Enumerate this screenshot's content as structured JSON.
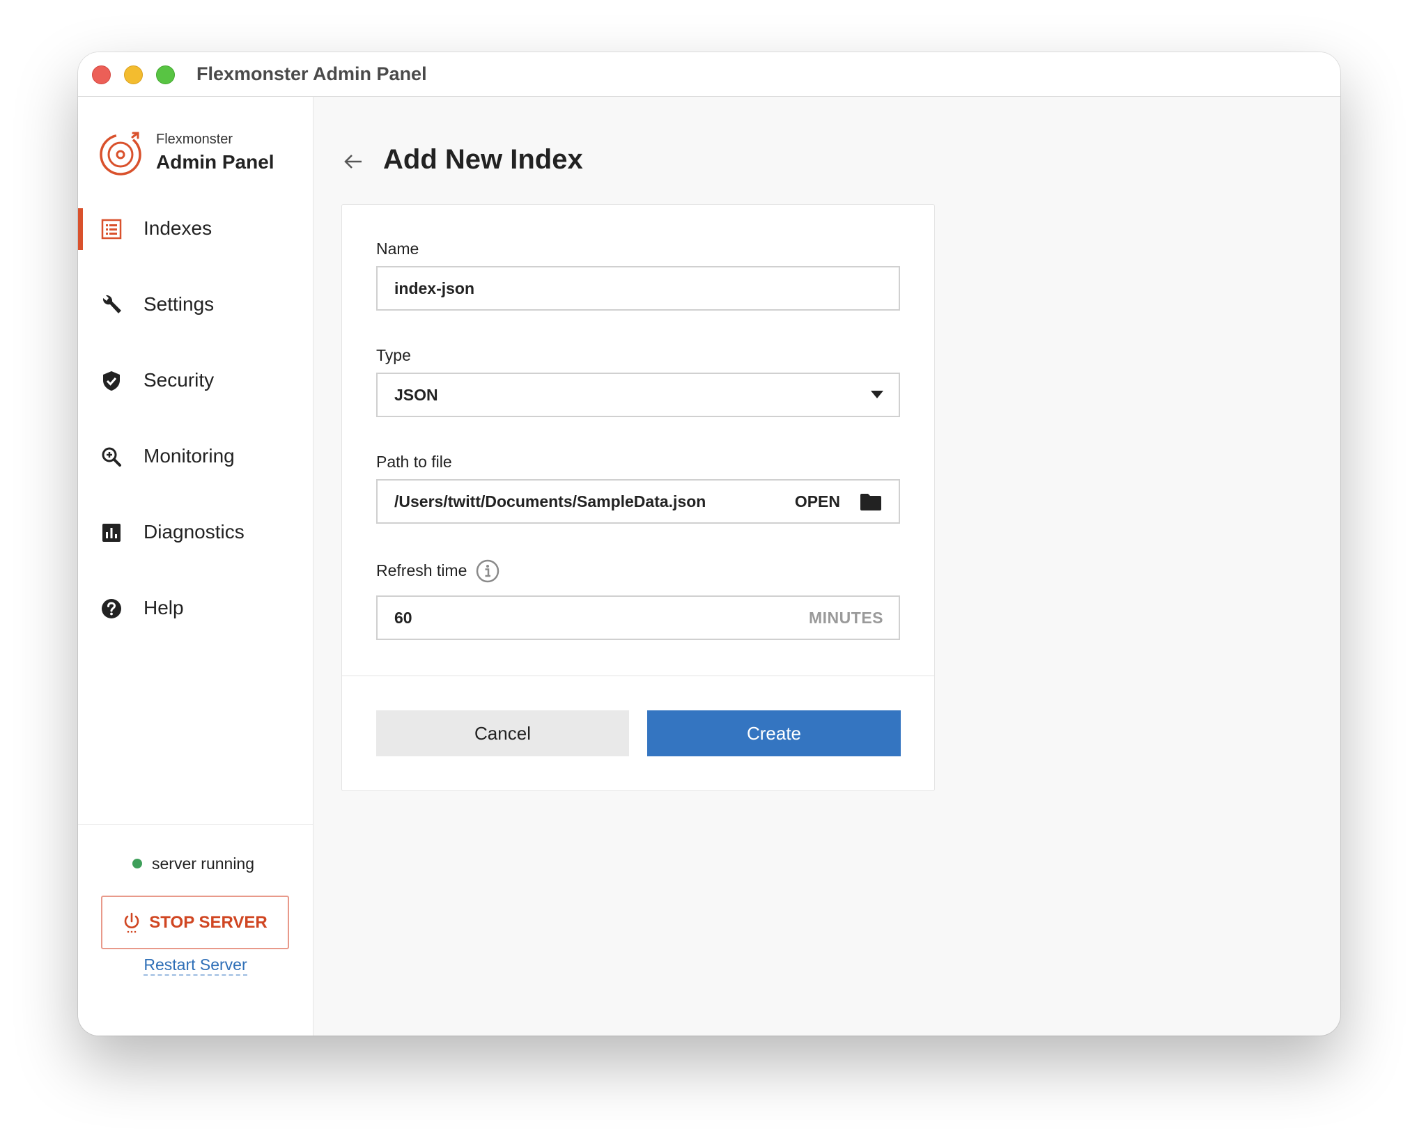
{
  "window": {
    "title": "Flexmonster Admin Panel"
  },
  "sidebar": {
    "brand_small": "Flexmonster",
    "brand_big": "Admin Panel",
    "items": [
      {
        "label": "Indexes",
        "icon": "list-icon",
        "active": true
      },
      {
        "label": "Settings",
        "icon": "wrench-icon",
        "active": false
      },
      {
        "label": "Security",
        "icon": "shield-check-icon",
        "active": false
      },
      {
        "label": "Monitoring",
        "icon": "magnifier-icon",
        "active": false
      },
      {
        "label": "Diagnostics",
        "icon": "bar-chart-icon",
        "active": false
      },
      {
        "label": "Help",
        "icon": "question-icon",
        "active": false
      }
    ],
    "status_text": "server running",
    "stop_label": "STOP SERVER",
    "restart_label": "Restart Server"
  },
  "main": {
    "title": "Add New Index",
    "form": {
      "name_label": "Name",
      "name_value": "index-json",
      "type_label": "Type",
      "type_value": "JSON",
      "path_label": "Path to file",
      "path_value": "/Users/twitt/Documents/SampleData.json",
      "open_label": "OPEN",
      "refresh_label": "Refresh time",
      "refresh_value": "60",
      "refresh_unit": "MINUTES"
    },
    "cancel_label": "Cancel",
    "create_label": "Create"
  },
  "colors": {
    "accent": "#d9512c",
    "primary_button": "#3475c1",
    "status_green": "#3e9f5a",
    "link": "#2f6fb7"
  }
}
